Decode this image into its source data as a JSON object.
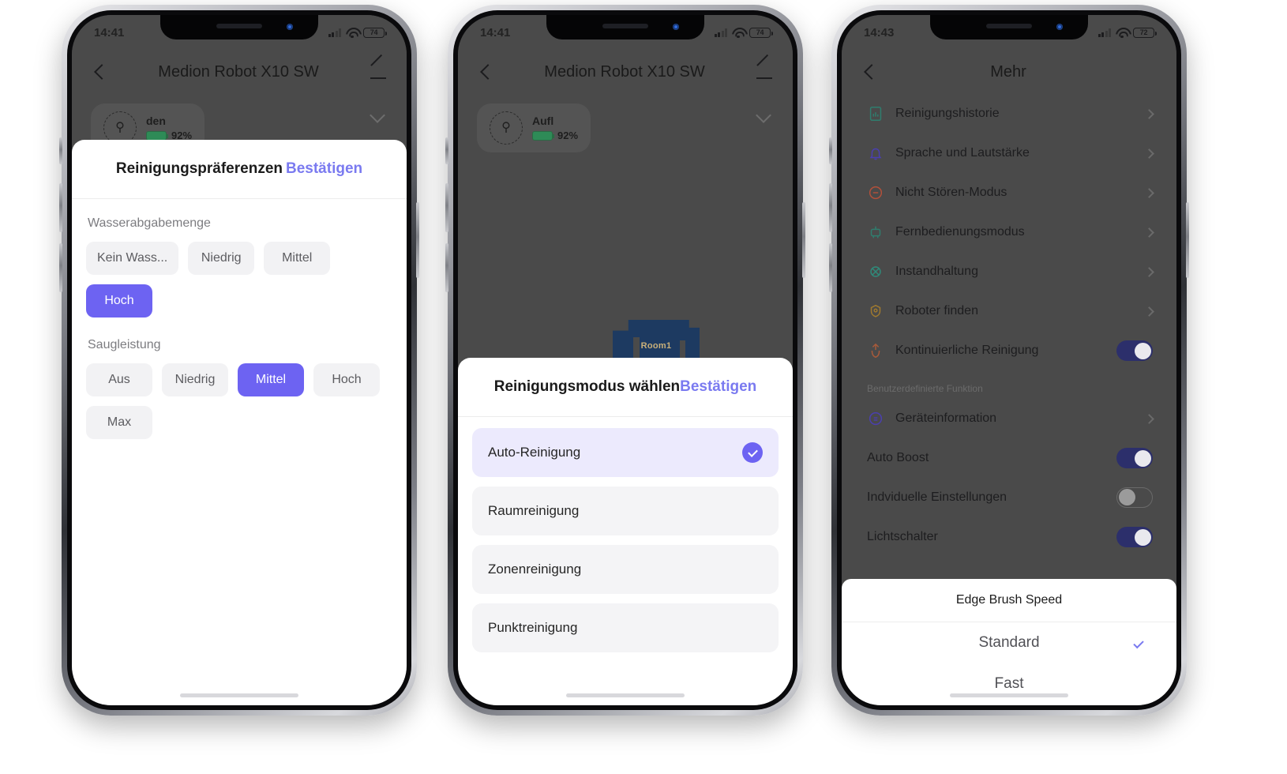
{
  "accent": "#6d63f2",
  "accent_link": "#7a7af0",
  "phone1": {
    "status": {
      "time": "14:41",
      "battery": "74"
    },
    "header": {
      "title": "Medion Robot X10 SW",
      "back_icon": "chevron-left-icon",
      "edit_icon": "pencil-icon"
    },
    "device_card": {
      "name": "den",
      "battery_pct": "92%"
    },
    "sheet": {
      "title": "Reinigungspräferenzen",
      "confirm": "Bestätigen",
      "groups": [
        {
          "label": "Wasserabgabemenge",
          "options": [
            {
              "label": "Kein Wass...",
              "selected": false
            },
            {
              "label": "Niedrig",
              "selected": false
            },
            {
              "label": "Mittel",
              "selected": false
            },
            {
              "label": "Hoch",
              "selected": true
            }
          ]
        },
        {
          "label": "Saugleistung",
          "options": [
            {
              "label": "Aus",
              "selected": false
            },
            {
              "label": "Niedrig",
              "selected": false
            },
            {
              "label": "Mittel",
              "selected": true
            },
            {
              "label": "Hoch",
              "selected": false
            },
            {
              "label": "Max",
              "selected": false
            }
          ]
        }
      ]
    }
  },
  "phone2": {
    "status": {
      "time": "14:41",
      "battery": "74"
    },
    "header": {
      "title": "Medion Robot X10 SW",
      "back_icon": "chevron-left-icon",
      "edit_icon": "pencil-icon"
    },
    "device_card": {
      "name": "Aufl",
      "battery_pct": "92%"
    },
    "map": {
      "room_label": "Room1"
    },
    "sheet": {
      "title": "Reinigungsmodus wählen",
      "confirm": "Bestätigen",
      "options": [
        {
          "label": "Auto-Reinigung",
          "selected": true
        },
        {
          "label": "Raumreinigung",
          "selected": false
        },
        {
          "label": "Zonenreinigung",
          "selected": false
        },
        {
          "label": "Punktreinigung",
          "selected": false
        }
      ]
    }
  },
  "phone3": {
    "status": {
      "time": "14:43",
      "battery": "72"
    },
    "header": {
      "title": "Mehr",
      "back_icon": "chevron-left-icon"
    },
    "rows": [
      {
        "label": "Reinigungshistorie",
        "icon": "history-document-icon",
        "color": "#2f7d6e",
        "control": "chevron"
      },
      {
        "label": "Sprache und Lautstärke",
        "icon": "bell-icon",
        "color": "#4a3fb0",
        "control": "chevron"
      },
      {
        "label": "Nicht Stören-Modus",
        "icon": "do-not-disturb-icon",
        "color": "#b3503a",
        "control": "chevron"
      },
      {
        "label": "Fernbedienungsmodus",
        "icon": "remote-control-icon",
        "color": "#2f7d6e",
        "control": "chevron"
      },
      {
        "label": "Instandhaltung",
        "icon": "maintenance-icon",
        "color": "#2f8a7a",
        "control": "chevron"
      },
      {
        "label": "Roboter finden",
        "icon": "locate-robot-icon",
        "color": "#a07a2f",
        "control": "chevron"
      },
      {
        "label": "Kontinuierliche Reinigung",
        "icon": "continuous-clean-icon",
        "color": "#a85a3a",
        "control": "toggle-on"
      }
    ],
    "section_title": "Benutzerdefinierte Funktion",
    "rows2": [
      {
        "label": "Geräteinformation",
        "icon": "info-circle-icon",
        "color": "#4a3fb0",
        "control": "chevron"
      },
      {
        "label": "Auto Boost",
        "icon": "",
        "color": "",
        "control": "toggle-on"
      },
      {
        "label": "Indviduelle Einstellungen",
        "icon": "",
        "color": "",
        "control": "toggle-off"
      },
      {
        "label": "Lichtschalter",
        "icon": "",
        "color": "",
        "control": "toggle-on"
      }
    ],
    "picker": {
      "title": "Edge Brush Speed",
      "options": [
        {
          "label": "Standard",
          "selected": true
        },
        {
          "label": "Fast",
          "selected": false
        }
      ]
    }
  }
}
